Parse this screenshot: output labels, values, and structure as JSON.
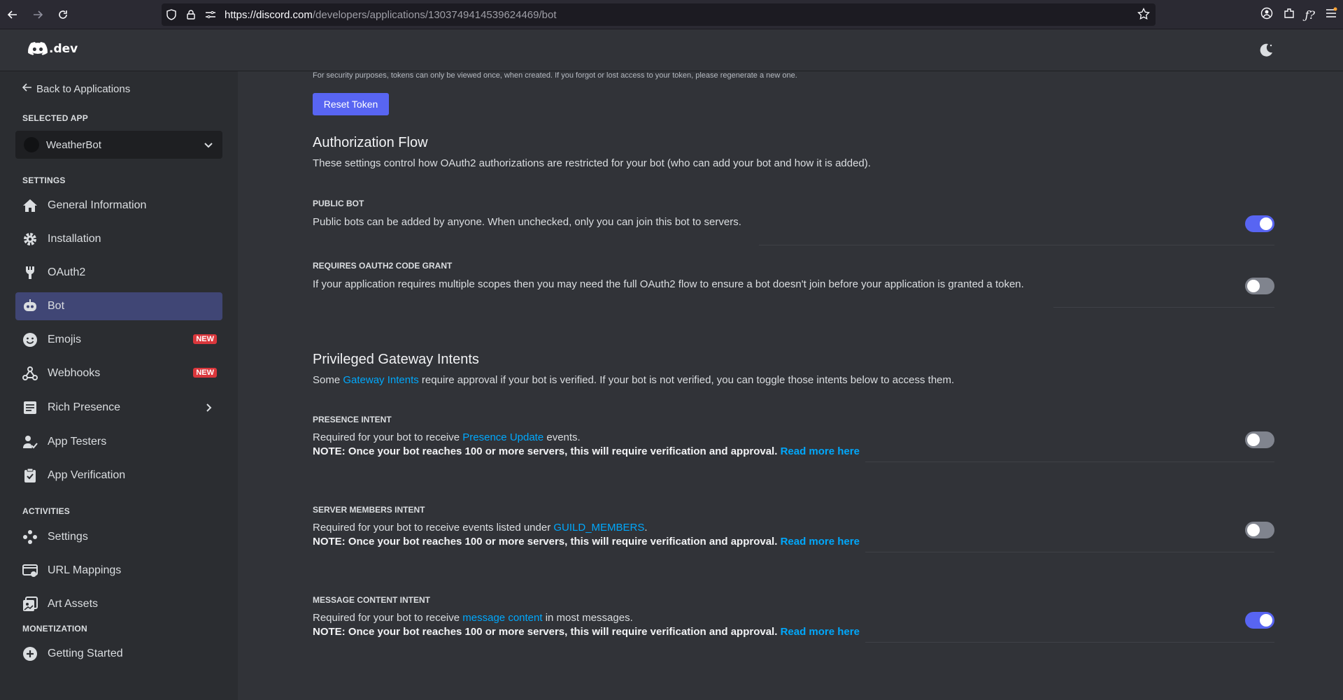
{
  "browser": {
    "url_host": "https://discord.com",
    "url_path": "/developers/applications/1303749414539624469/bot"
  },
  "header": {
    "logo_text": ".dev"
  },
  "sidebar": {
    "back_label": "Back to Applications",
    "selected_app_label": "SELECTED APP",
    "app_name": "WeatherBot",
    "settings_label": "SETTINGS",
    "activities_label": "ACTIVITIES",
    "monetization_label": "MONETIZATION",
    "new_badge": "NEW",
    "items": {
      "general": "General Information",
      "installation": "Installation",
      "oauth2": "OAuth2",
      "bot": "Bot",
      "emojis": "Emojis",
      "webhooks": "Webhooks",
      "rich_presence": "Rich Presence",
      "app_testers": "App Testers",
      "app_verification": "App Verification",
      "act_settings": "Settings",
      "url_mappings": "URL Mappings",
      "art_assets": "Art Assets",
      "getting_started": "Getting Started"
    }
  },
  "main": {
    "security_note": "For security purposes, tokens can only be viewed once, when created. If you forgot or lost access to your token, please regenerate a new one.",
    "reset_token": "Reset Token",
    "auth_flow": {
      "title": "Authorization Flow",
      "desc": "These settings control how OAuth2 authorizations are restricted for your bot (who can add your bot and how it is added).",
      "public_bot_label": "PUBLIC BOT",
      "public_bot_text": "Public bots can be added by anyone. When unchecked, only you can join this bot to servers.",
      "code_grant_label": "REQUIRES OAUTH2 CODE GRANT",
      "code_grant_text": "If your application requires multiple scopes then you may need the full OAuth2 flow to ensure a bot doesn't join before your application is granted a token."
    },
    "intents": {
      "title": "Privileged Gateway Intents",
      "desc_pre": "Some ",
      "desc_link": "Gateway Intents",
      "desc_post": " require approval if your bot is verified. If your bot is not verified, you can toggle those intents below to access them.",
      "note": "NOTE: Once your bot reaches 100 or more servers, this will require verification and approval. ",
      "read_more": "Read more here",
      "presence_label": "PRESENCE INTENT",
      "presence_pre": "Required for your bot to receive ",
      "presence_link": "Presence Update",
      "presence_post": " events.",
      "members_label": "SERVER MEMBERS INTENT",
      "members_pre": "Required for your bot to receive events listed under ",
      "members_link": "GUILD_MEMBERS",
      "members_post": ".",
      "message_label": "MESSAGE CONTENT INTENT",
      "message_pre": "Required for your bot to receive ",
      "message_link": "message content",
      "message_post": " in most messages."
    }
  },
  "toggles": {
    "public_bot": "on",
    "code_grant": "off",
    "presence": "off",
    "members": "off",
    "message_content": "on"
  },
  "colors": {
    "accent": "#5865f2",
    "link": "#00a8fc",
    "badge": "#da373c"
  }
}
